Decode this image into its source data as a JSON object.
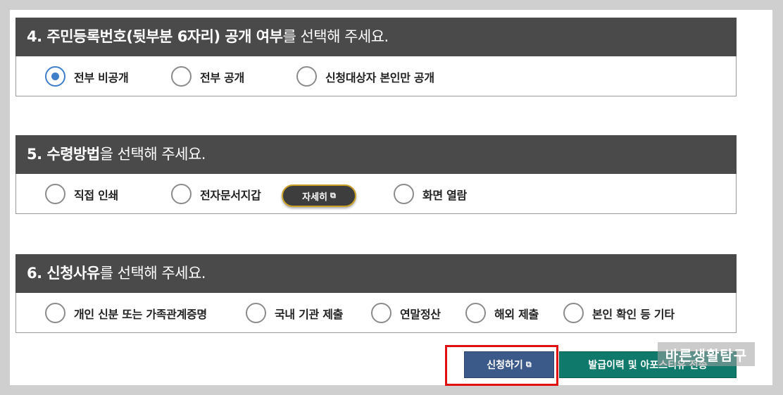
{
  "sections": [
    {
      "header_bold": "4. 주민등록번호(뒷부분 6자리) 공개 여부",
      "header_rest": "를 선택해 주세요.",
      "options": [
        "전부 비공개",
        "전부 공개",
        "신청대상자 본인만 공개"
      ],
      "selected_index": 0
    },
    {
      "header_bold": "5. 수령방법",
      "header_rest": "을 선택해 주세요.",
      "options": [
        "직접 인쇄",
        "전자문서지갑",
        "화면 열람"
      ],
      "detail_button": "자세히",
      "selected_index": null
    },
    {
      "header_bold": "6. 신청사유",
      "header_rest": "를 선택해 주세요.",
      "options": [
        "개인 신분 또는 가족관계증명",
        "국내 기관 제출",
        "연말정산",
        "해외 제출",
        "본인 확인 등 기타"
      ],
      "selected_index": null
    }
  ],
  "actions": {
    "apply_label": "신청하기",
    "history_label": "발급이력 및 아포스티유 전송"
  },
  "watermark": "바른생활탐구",
  "icons": {
    "external": "external-link-icon",
    "radio_checked": "radio-checked-icon",
    "radio_unchecked": "radio-unchecked-icon"
  },
  "colors": {
    "header_bg": "#4a4a4a",
    "radio_accent": "#3f7fc9",
    "apply_bg": "#3b5a8a",
    "history_bg": "#0f7a6b",
    "highlight": "#e01010"
  }
}
